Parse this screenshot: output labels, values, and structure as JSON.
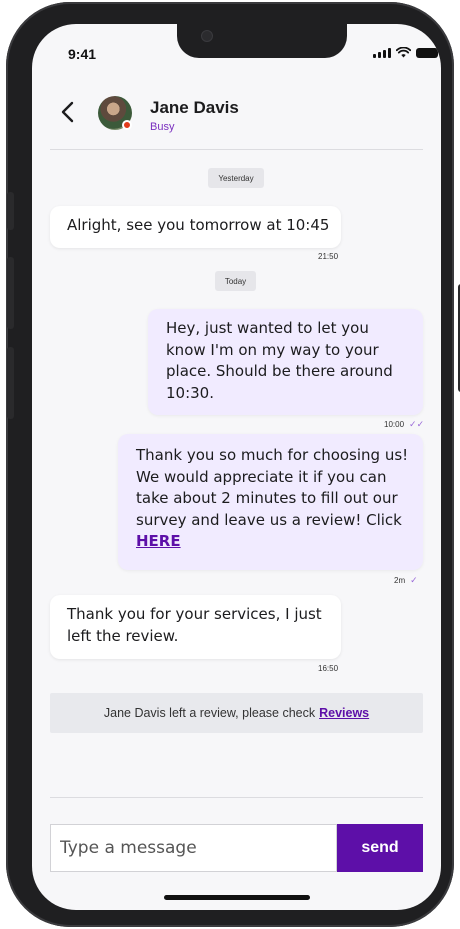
{
  "status_bar": {
    "time": "9:41"
  },
  "header": {
    "contact_name": "Jane Davis",
    "contact_status": "Busy",
    "status_color": "#e23b1c"
  },
  "chat": {
    "date_yesterday": "Yesterday",
    "date_today": "Today",
    "messages": [
      {
        "direction": "in",
        "text": "Alright, see you tomorrow at 10:45",
        "time": "21:50"
      },
      {
        "direction": "out",
        "text": "Hey, just wanted to let you know I'm on my way to your place. Should be there around 10:30.",
        "time": "10:00"
      },
      {
        "direction": "out",
        "text": "Thank you so much for choosing us! We would appreciate it if you can take about 2 minutes to fill out our survey and leave us a review! Click",
        "link": "HERE",
        "time": "2m"
      },
      {
        "direction": "in",
        "text": "Thank you for your services, I just left the review.",
        "time": "16:50"
      }
    ],
    "review_notice": {
      "text": "Jane Davis left a review, please check",
      "link": "Reviews"
    }
  },
  "composer": {
    "placeholder": "Type a message",
    "send_label": "send"
  },
  "colors": {
    "accent": "#5d0fa8",
    "outgoing_bubble": "#f1ebff",
    "incoming_bubble": "#ffffff",
    "status_busy": "#e23b1c"
  }
}
